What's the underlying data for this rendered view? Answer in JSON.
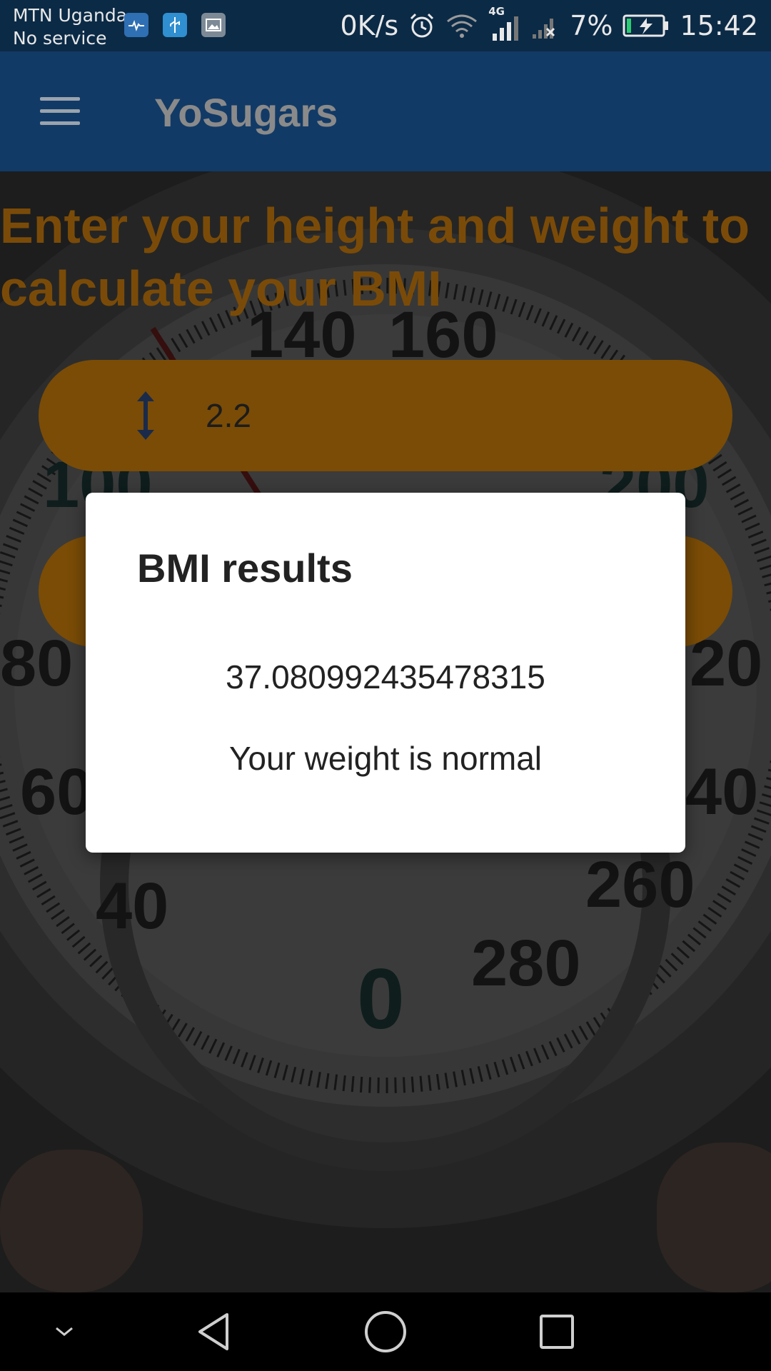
{
  "status_bar": {
    "carrier_line1": "MTN Uganda",
    "carrier_line2": "No service",
    "net_speed": "0K/s",
    "network_type": "4G",
    "battery": "7%",
    "time": "15:42",
    "icons": [
      "health-icon",
      "usb-icon",
      "gallery-icon",
      "alarm-icon",
      "wifi-icon",
      "signal-icon",
      "no-signal-icon",
      "battery-charging-icon"
    ]
  },
  "app_bar": {
    "title": "YoSugars",
    "menu_icon": "hamburger-menu-icon",
    "color": "#123a66"
  },
  "main": {
    "heading": "Enter your height and weight to calculate your BMI",
    "heading_color": "#7a4b08",
    "height_field": {
      "icon": "height-arrows-icon",
      "value": "2.2"
    },
    "weight_field": {
      "value": ""
    },
    "field_color": "#7a4c06"
  },
  "dialog": {
    "title": "BMI results",
    "bmi_value": "37.080992435478315",
    "message": "Your weight is normal"
  },
  "nav_bar": {
    "buttons": [
      "chevron-down-icon",
      "back-icon",
      "home-icon",
      "recents-icon"
    ]
  }
}
